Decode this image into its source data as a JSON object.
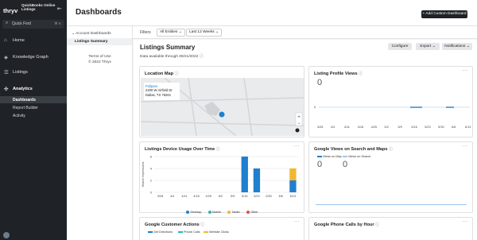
{
  "sidebar": {
    "logo": "thryv",
    "app_name": "QuickBooks Online Listings",
    "quick_find": {
      "placeholder": "Quick Find",
      "shortcut": "⌘ K"
    },
    "nav": [
      {
        "label": "Home"
      },
      {
        "label": "Knowledge Graph"
      },
      {
        "label": "Listings"
      },
      {
        "label": "Analytics"
      }
    ],
    "analytics_sub": [
      {
        "label": "Dashboards"
      },
      {
        "label": "Report Builder"
      },
      {
        "label": "Activity"
      }
    ]
  },
  "header": {
    "title": "Dashboards",
    "add_button": "+ Add Custom Dashboard"
  },
  "filters": {
    "label": "Filters",
    "entities": "All Entities",
    "period": "Last 12 Weeks"
  },
  "leftnav": {
    "parent": "Account Dashboards",
    "child": "Listings Summary",
    "footer_line1": "Terms of Use",
    "footer_line2": "© 2022 Thryv"
  },
  "summary": {
    "title": "Listings Summary",
    "subtitle": "Data available through 06/21/2022",
    "configure": "Configure",
    "export": "Export",
    "notifications": "Notifications"
  },
  "location_map": {
    "title": "Location Map",
    "place_name": "Pollpare",
    "address1": "2200 W Airfield Dr",
    "address2": "Dallas, TX 75261"
  },
  "profile_views": {
    "title": "Listing Profile Views",
    "value": "0",
    "zero_label": "0",
    "dates": [
      "3/28",
      "4/4",
      "4/11",
      "4/18",
      "4/25",
      "5/2",
      "5/9",
      "5/16",
      "5/23",
      "5/30",
      "6/6",
      "6/13"
    ]
  },
  "device_usage": {
    "title": "Listings Device Usage Over Time",
    "ylabel": "Search Impressions",
    "legend": [
      "Desktop",
      "Mobile",
      "Tablet",
      "Other"
    ]
  },
  "google_views": {
    "title": "Google Views on Search and Maps",
    "legend": [
      "Views on Map",
      "Views on Search"
    ],
    "values": [
      "0",
      "0"
    ]
  },
  "customer_actions": {
    "title": "Google Customer Actions",
    "legend": [
      "Get Directions",
      "Phone Calls",
      "Website Clicks"
    ]
  },
  "phone_calls": {
    "title": "Google Phone Calls by Hour"
  },
  "colors": {
    "accent": "#1f7fd0",
    "mobile": "#2bb6b0",
    "tablet": "#f2b731",
    "other": "#d9534f",
    "sidebar": "#1f2226"
  },
  "chart_data": {
    "type": "bar",
    "title": "Listings Device Usage Over Time",
    "ylabel": "Search Impressions",
    "categories": [
      "3/28",
      "4/4",
      "4/11",
      "4/18",
      "4/25",
      "5/2",
      "5/9",
      "5/16",
      "5/23",
      "5/30",
      "6/6",
      "6/13"
    ],
    "ylim": [
      0,
      6
    ],
    "yticks": [
      0,
      2,
      4,
      6
    ],
    "series": [
      {
        "name": "Desktop",
        "color": "#1f7fd0",
        "values": [
          0,
          0,
          0,
          0,
          0,
          0,
          0,
          6,
          4,
          0,
          0,
          2
        ]
      },
      {
        "name": "Mobile",
        "color": "#2bb6b0",
        "values": [
          0,
          0,
          0,
          0,
          0,
          0,
          0,
          0,
          0,
          0,
          0,
          0
        ]
      },
      {
        "name": "Tablet",
        "color": "#f2b731",
        "values": [
          0,
          0,
          0,
          0,
          0,
          0,
          0,
          0,
          0,
          0,
          0,
          2
        ]
      },
      {
        "name": "Other",
        "color": "#d9534f",
        "values": [
          0,
          0,
          0,
          0,
          0,
          0,
          0,
          0,
          0,
          0,
          0,
          0
        ]
      }
    ]
  }
}
